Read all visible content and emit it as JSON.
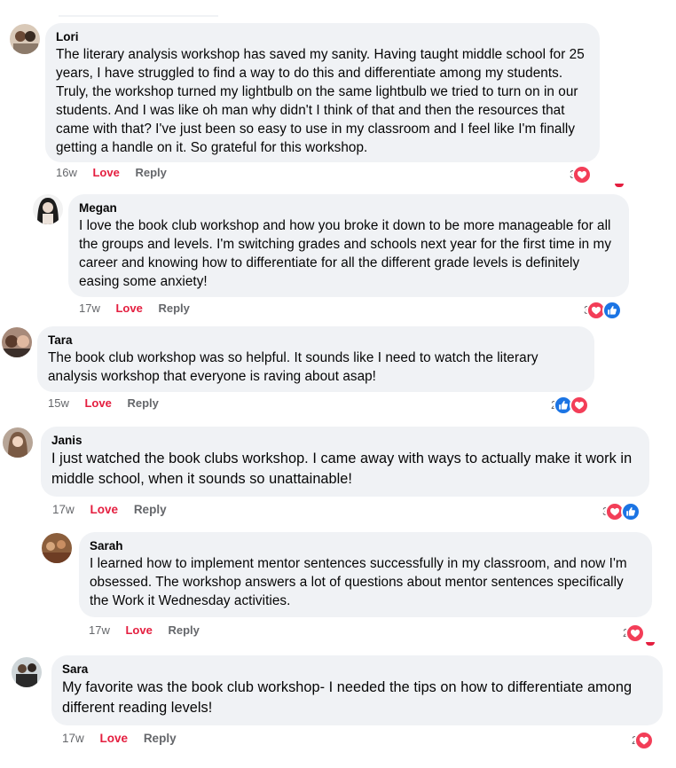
{
  "colors": {
    "bubble": "#f0f2f5",
    "love": "#e41e3f",
    "like": "#1877f2",
    "meta": "#65676b"
  },
  "comments": [
    {
      "author": "Lori",
      "text": "The literary analysis workshop has saved my sanity. Having taught middle school for 25 years, I have struggled to find a way to do this and differentiate among my students. Truly, the workshop turned my lightbulb on the same lightbulb we tried to turn on in our students. And I was like oh man why didn't I think of that and then the resources that came with that? I've just been so easy to use in my classroom and I feel like I'm finally getting a handle on it. So grateful for this workshop.",
      "time": "16w",
      "love_label": "Love",
      "reply_label": "Reply",
      "reaction_count": "3",
      "reactions": [
        "love-icon"
      ]
    },
    {
      "author": "Megan",
      "text": "I love the book club workshop and how you broke it down to be more manageable for all the groups and levels. I'm switching grades and schools next year for the first time in my career and knowing how to differentiate for all the different grade levels is definitely easing some anxiety!",
      "time": "17w",
      "love_label": "Love",
      "reply_label": "Reply",
      "reaction_count": "3",
      "reactions": [
        "love-icon",
        "like-icon"
      ]
    },
    {
      "author": "Tara",
      "text": "The book club workshop was so helpful. It sounds like I need to watch the literary analysis workshop that everyone is raving about asap!",
      "time": "15w",
      "love_label": "Love",
      "reply_label": "Reply",
      "reaction_count": "2",
      "reactions": [
        "like-icon",
        "love-icon"
      ]
    },
    {
      "author": "Janis",
      "text": "I just watched the book clubs workshop. I came away with ways to actually make it work in middle school, when it sounds so unattainable!",
      "time": "17w",
      "love_label": "Love",
      "reply_label": "Reply",
      "reaction_count": "3",
      "reactions": [
        "love-icon",
        "like-icon"
      ]
    },
    {
      "author": "Sarah",
      "text": "I learned how to implement mentor sentences successfully in my classroom, and now I'm obsessed. The workshop answers a lot of questions about mentor sentences specifically the Work it Wednesday activities.",
      "time": "17w",
      "love_label": "Love",
      "reply_label": "Reply",
      "reaction_count": "2",
      "reactions": [
        "love-icon"
      ]
    },
    {
      "author": "Sara",
      "text": "My favorite was the book club workshop- I needed the tips on how to differentiate among different reading levels!",
      "time": "17w",
      "love_label": "Love",
      "reply_label": "Reply",
      "reaction_count": "2",
      "reactions": [
        "love-icon"
      ]
    }
  ]
}
